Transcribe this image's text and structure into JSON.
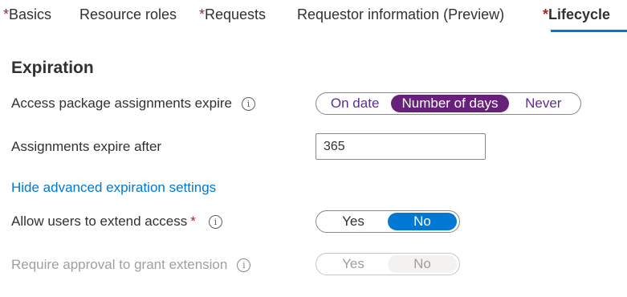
{
  "tabs": [
    {
      "label": "Basics",
      "required": "*"
    },
    {
      "label": "Resource roles",
      "required": ""
    },
    {
      "label": "Requests",
      "required": "*"
    },
    {
      "label": "Requestor information (Preview)",
      "required": ""
    },
    {
      "label": "Lifecycle",
      "required": "*",
      "active": true
    }
  ],
  "section": {
    "title": "Expiration"
  },
  "expire_setting": {
    "label": "Access package assignments expire",
    "options": [
      "On date",
      "Number of days",
      "Never"
    ],
    "selected": "Number of days"
  },
  "expire_after": {
    "label": "Assignments expire after",
    "value": "365"
  },
  "advanced_link": "Hide advanced expiration settings",
  "extend_access": {
    "label": "Allow users to extend access",
    "required": "*",
    "options": [
      "Yes",
      "No"
    ],
    "selected": "No"
  },
  "require_approval": {
    "label": "Require approval to grant extension",
    "options": [
      "Yes",
      "No"
    ],
    "selected": "No",
    "disabled": true
  },
  "icons": {
    "info": "info-icon",
    "info_glyph": "i"
  },
  "colors": {
    "accent": "#0078d4",
    "selected_pill": "#68217a",
    "required": "#a4262c"
  }
}
